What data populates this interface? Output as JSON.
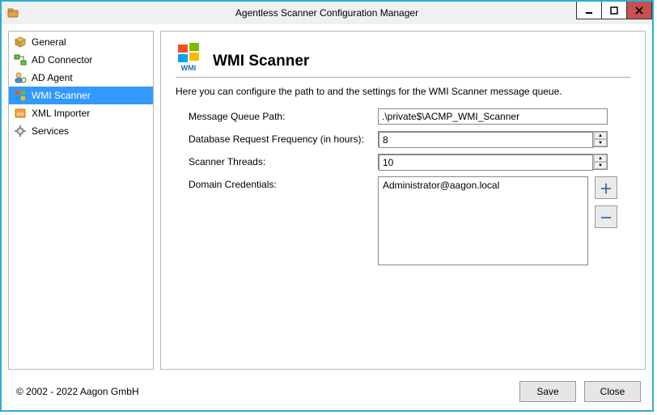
{
  "window": {
    "title": "Agentless Scanner Configuration Manager"
  },
  "sidebar": {
    "items": [
      {
        "label": "General"
      },
      {
        "label": "AD Connector"
      },
      {
        "label": "AD Agent"
      },
      {
        "label": "WMI Scanner",
        "selected": true
      },
      {
        "label": "XML Importer"
      },
      {
        "label": "Services"
      }
    ]
  },
  "main": {
    "heading": "WMI Scanner",
    "description": "Here you can configure the path to and the settings for the WMI Scanner message queue.",
    "labels": {
      "queue": "Message Queue Path:",
      "freq": "Database Request Frequency (in hours):",
      "threads": "Scanner Threads:",
      "creds": "Domain Credentials:"
    },
    "values": {
      "queue": ".\\private$\\ACMP_WMI_Scanner",
      "freq": "8",
      "threads": "10"
    },
    "creds_list": [
      "Administrator@aagon.local"
    ]
  },
  "footer": {
    "copyright": "© 2002 - 2022 Aagon GmbH",
    "save": "Save",
    "close": "Close"
  }
}
